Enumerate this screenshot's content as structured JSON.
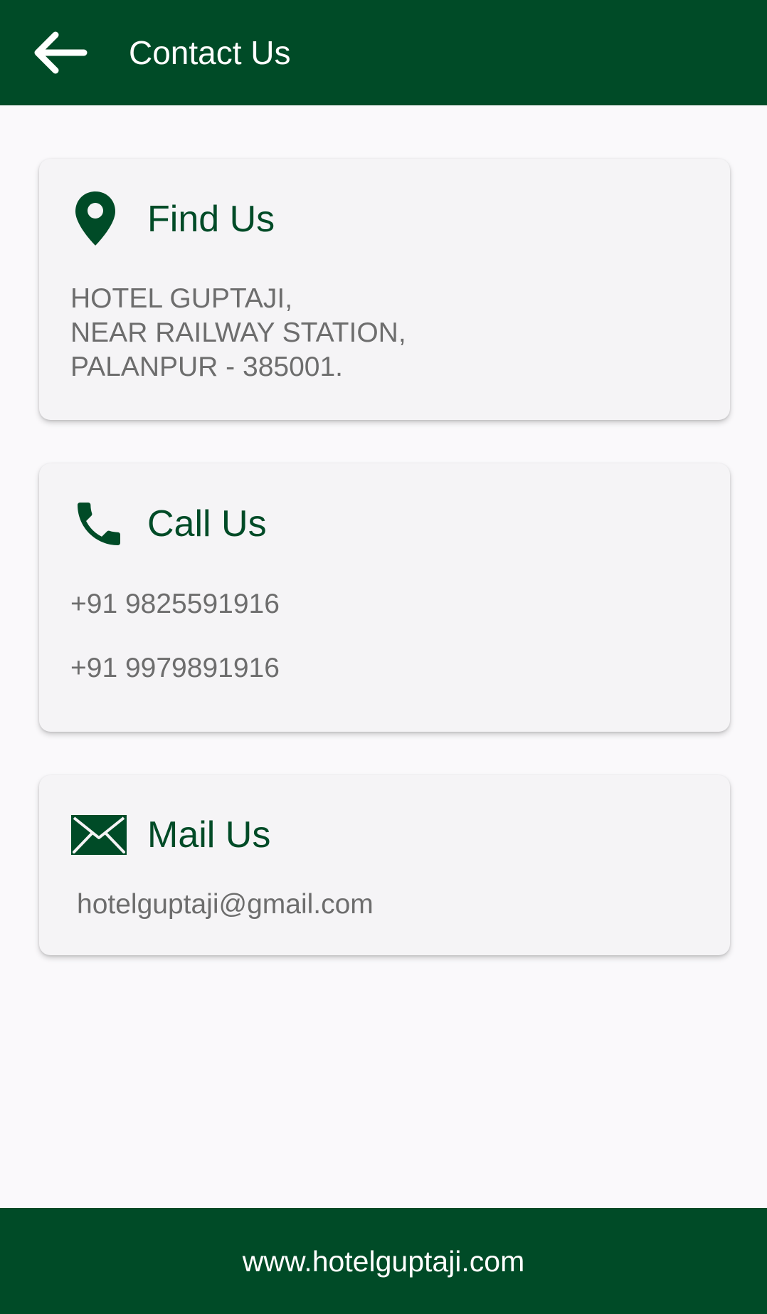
{
  "app_bar": {
    "title": "Contact Us",
    "back_icon": "arrow-left-icon"
  },
  "cards": {
    "find": {
      "icon": "map-pin-icon",
      "title": "Find Us",
      "address_lines": [
        "HOTEL GUPTAJI,",
        "NEAR RAILWAY STATION,",
        "PALANPUR - 385001."
      ]
    },
    "call": {
      "icon": "phone-icon",
      "title": "Call Us",
      "phones": [
        "+91 9825591916",
        "+91 9979891916"
      ]
    },
    "mail": {
      "icon": "envelope-icon",
      "title": "Mail Us",
      "email": "hotelguptaji@gmail.com"
    }
  },
  "footer": {
    "website": "www.hotelguptaji.com"
  },
  "colors": {
    "brand": "#004b27",
    "background": "#faf9fb",
    "card": "#f5f4f6",
    "body_text": "#6d6d6d"
  }
}
